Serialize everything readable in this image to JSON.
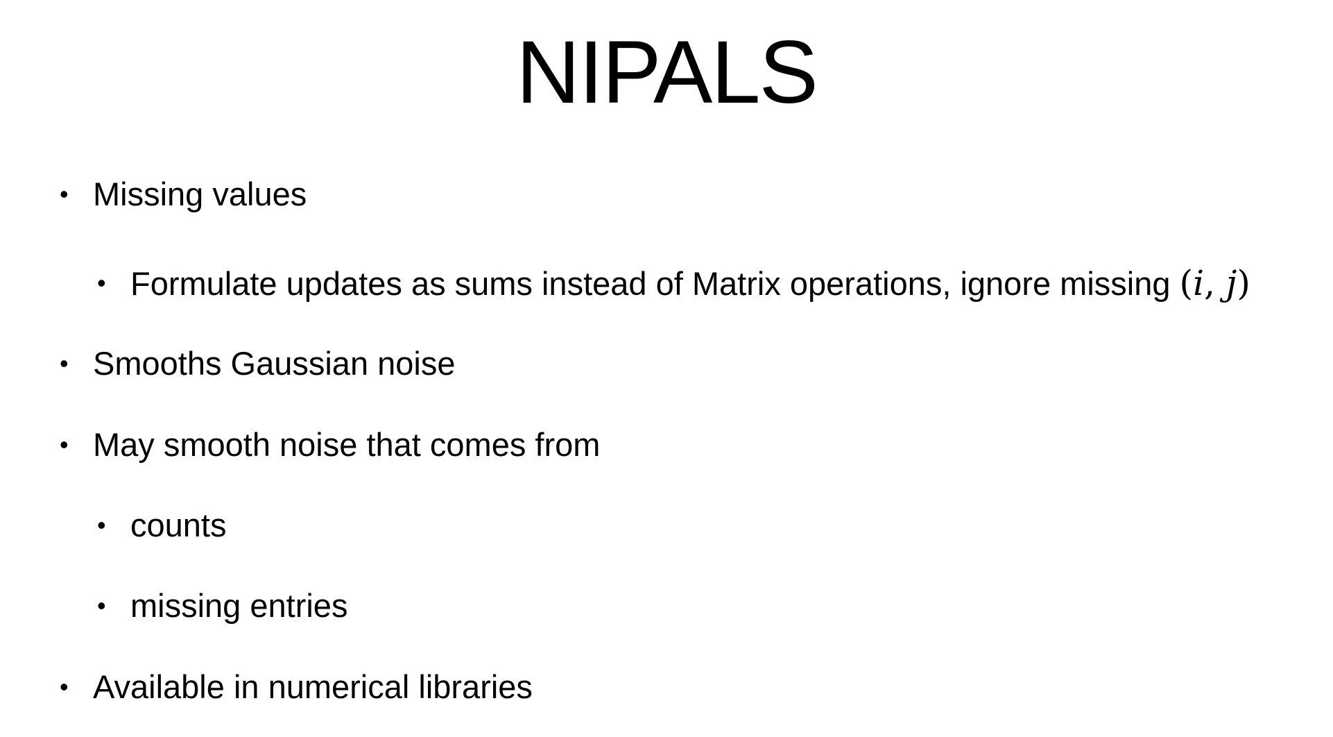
{
  "slide": {
    "title": "NIPALS",
    "bullets": [
      {
        "text": "Missing values"
      },
      {
        "text": "Formulate updates as sums instead of Matrix operations, ignore missing ",
        "math": {
          "open": "(",
          "i": "i",
          "sep": ", ",
          "j": "j",
          "close": ")"
        }
      },
      {
        "text": "Smooths Gaussian noise"
      },
      {
        "text": "May smooth noise that comes from"
      },
      {
        "text": "counts"
      },
      {
        "text": "missing entries"
      },
      {
        "text": "Available in numerical libraries"
      }
    ],
    "bullet_symbol": "•"
  }
}
